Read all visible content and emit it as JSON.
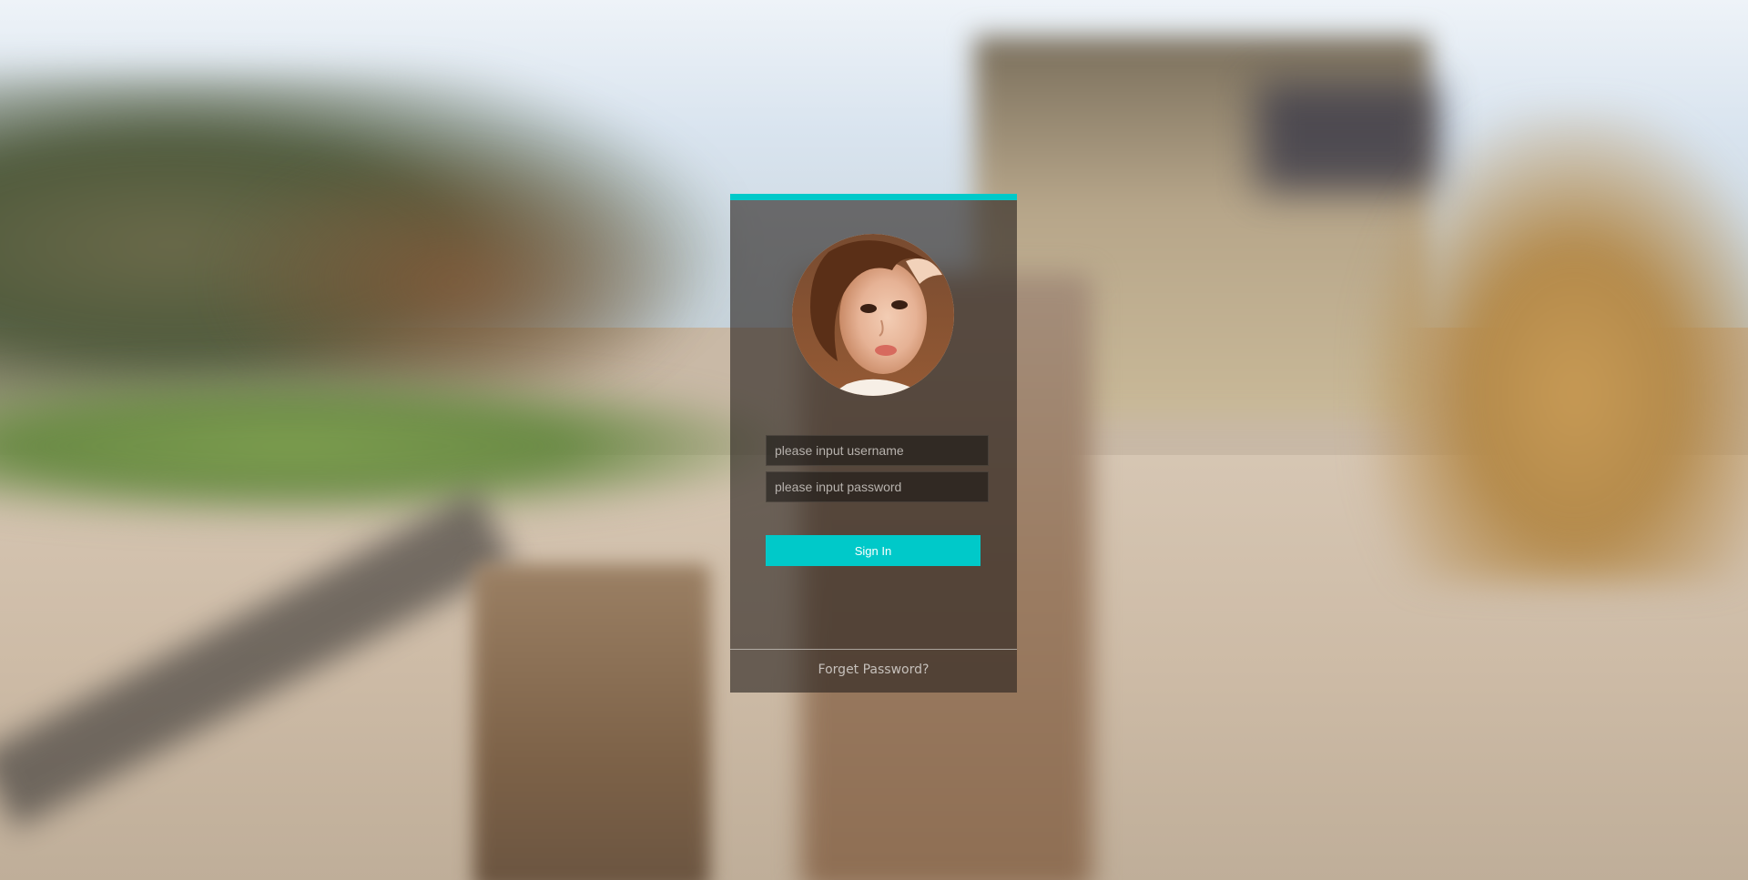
{
  "login": {
    "username_placeholder": "please input username",
    "password_placeholder": "please input password",
    "sign_in_label": "Sign In",
    "forget_password_label": "Forget Password?"
  },
  "colors": {
    "accent": "#00c9c9",
    "card_background": "rgba(40, 34, 30, 0.62)",
    "link_text": "#c6c0bb"
  },
  "icons": {
    "avatar": "user-avatar-photo"
  }
}
